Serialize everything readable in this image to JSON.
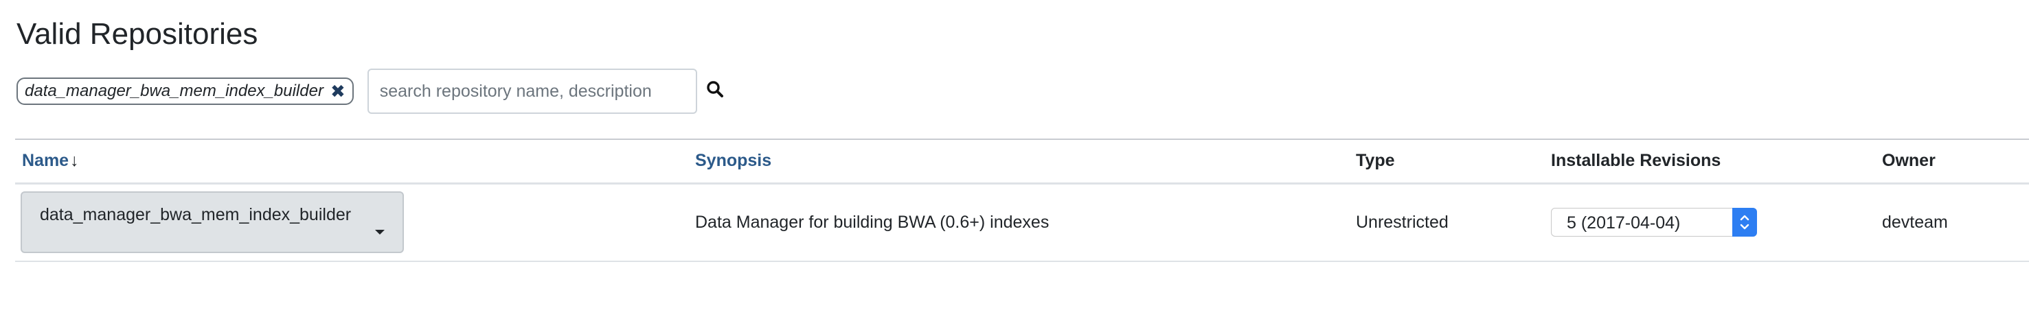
{
  "page": {
    "title": "Valid Repositories"
  },
  "filter": {
    "active_tag": "data_manager_bwa_mem_index_builder",
    "search_placeholder": "search repository name, description"
  },
  "table": {
    "columns": {
      "name": "Name",
      "name_sort_indicator": "↓",
      "synopsis": "Synopsis",
      "type": "Type",
      "installable_revisions": "Installable Revisions",
      "owner": "Owner"
    },
    "rows": [
      {
        "name": "data_manager_bwa_mem_index_builder",
        "synopsis": "Data Manager for building BWA (0.6+) indexes",
        "type": "Unrestricted",
        "installable_revision": "5 (2017-04-04)",
        "owner": "devteam"
      }
    ]
  },
  "icons": {
    "remove_tag": "close-icon",
    "search": "search-icon",
    "dropdown": "caret-down-icon",
    "revision_stepper": "stepper-icon"
  },
  "colors": {
    "link": "#2c5a8a",
    "tag_close": "#1f3b5e",
    "select_accent": "#2d7ef2",
    "dropdown_bg": "#dfe3e6"
  }
}
